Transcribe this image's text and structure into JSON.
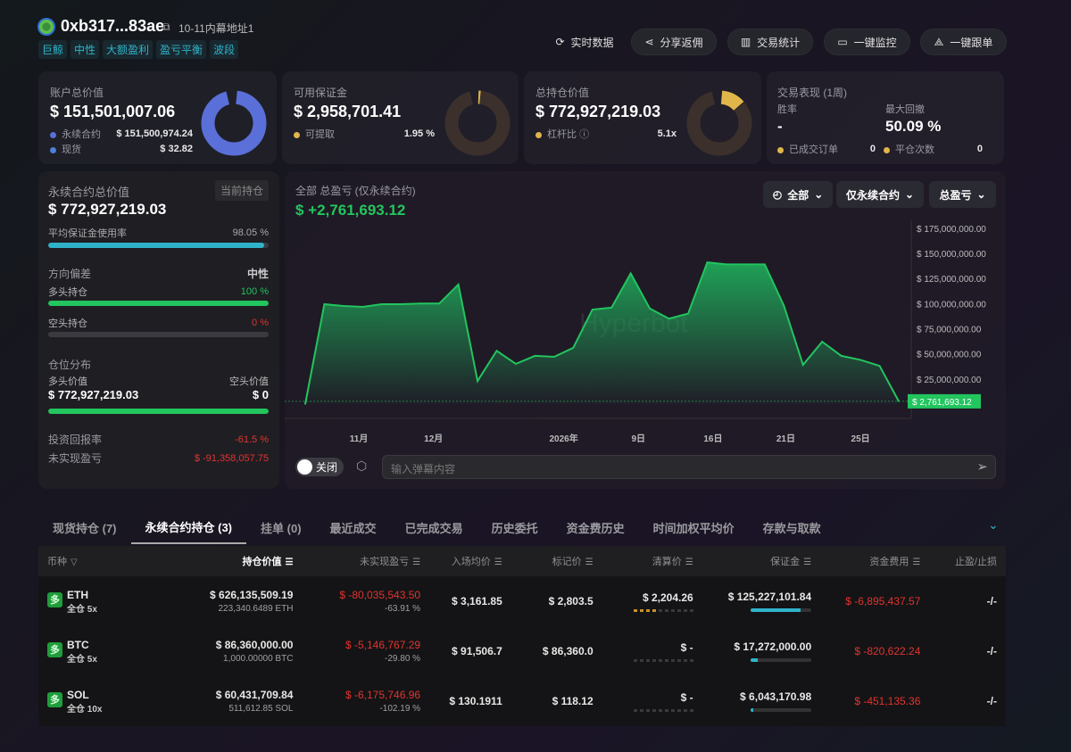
{
  "header": {
    "address": "0xb317...83ae",
    "alias": "10-11内幕地址1",
    "tags": [
      "巨鲸",
      "中性",
      "大额盈利",
      "盈亏平衡",
      "波段"
    ]
  },
  "toolbar": {
    "realtime": "实时数据",
    "share": "分享返佣",
    "stats": "交易统计",
    "monitor": "一键监控",
    "copy": "一键跟单"
  },
  "cards": {
    "account": {
      "title": "账户总价值",
      "value": "$ 151,501,007.06",
      "perp_label": "永续合约",
      "perp_value": "$ 151,500,974.24",
      "spot_label": "现货",
      "spot_value": "$ 32.82",
      "perp_color": "#5a6fd8",
      "spot_color": "#4f7fd8"
    },
    "margin": {
      "title": "可用保证金",
      "value": "$ 2,958,701.41",
      "withdraw_label": "可提取",
      "withdraw_pct": "1.95 %",
      "fraction": 0.0195
    },
    "position": {
      "title": "总持仓价值",
      "value": "$ 772,927,219.03",
      "leverage_label": "杠杆比",
      "leverage": "5.1x"
    },
    "performance": {
      "title": "交易表现 (1周)",
      "winrate_label": "胜率",
      "winrate": "-",
      "drawdown_label": "最大回撤",
      "drawdown": "50.09 %",
      "filled_label": "已成交订单",
      "filled": "0",
      "closed_label": "平仓次数",
      "closed": "0"
    }
  },
  "perp": {
    "title": "永续合约总价值",
    "badge": "当前持仓",
    "value": "$ 772,927,219.03",
    "margin_use_label": "平均保证金使用率",
    "margin_use": "98.05 %",
    "margin_use_frac": 0.9805,
    "bias_label": "方向偏差",
    "bias": "中性",
    "long_label": "多头持仓",
    "long_pct": "100 %",
    "long_frac": 1,
    "short_label": "空头持仓",
    "short_pct": "0 %",
    "short_frac": 0,
    "dist_label": "仓位分布",
    "long_value_label": "多头价值",
    "short_value_label": "空头价值",
    "long_value": "$ 772,927,219.03",
    "short_value": "$ 0",
    "roi_label": "投资回报率",
    "roi": "-61.5 %",
    "upnl_label": "未实现盈亏",
    "upnl": "$ -91,358,057.75"
  },
  "chart_panel": {
    "title": "全部 总盈亏 (仅永续合约)",
    "total": "$ +2,761,693.12",
    "dd_range": "全部",
    "dd_type": "仅永续合约",
    "dd_metric": "总盈亏",
    "watermark": "Hyperbot",
    "toggle": "关闭",
    "danmaku_placeholder": "输入弹幕内容"
  },
  "chart_data": {
    "type": "area",
    "title": "全部 总盈亏 (仅永续合约)",
    "ylim": [
      0,
      175000000
    ],
    "yticks": [
      {
        "v": 175000000,
        "label": "$ 175,000,000.00"
      },
      {
        "v": 150000000,
        "label": "$ 150,000,000.00"
      },
      {
        "v": 125000000,
        "label": "$ 125,000,000.00"
      },
      {
        "v": 100000000,
        "label": "$ 100,000,000.00"
      },
      {
        "v": 75000000,
        "label": "$ 75,000,000.00"
      },
      {
        "v": 50000000,
        "label": "$ 50,000,000.00"
      },
      {
        "v": 25000000,
        "label": "$ 25,000,000.00"
      }
    ],
    "xticks": [
      {
        "i": 2.8,
        "label": "11月"
      },
      {
        "i": 6.7,
        "label": "12月"
      },
      {
        "i": 13.5,
        "label": "2026年"
      },
      {
        "i": 17.4,
        "label": "9日"
      },
      {
        "i": 21.3,
        "label": "16日"
      },
      {
        "i": 25.1,
        "label": "21日"
      },
      {
        "i": 29,
        "label": "25日"
      }
    ],
    "values": [
      0,
      99400000,
      97600000,
      96700000,
      99400000,
      99400000,
      100000000,
      100000000,
      119000000,
      23000000,
      53000000,
      40000000,
      48000000,
      47000000,
      56000000,
      94000000,
      96000000,
      130000000,
      95000000,
      85000000,
      90000000,
      141000000,
      139000000,
      139000000,
      139000000,
      98000000,
      39000000,
      62000000,
      48000000,
      44000000,
      38000000,
      2761693.12
    ],
    "last_label": "$ 2,761,693.12",
    "color": "#22c55e"
  },
  "tabs": [
    "现货持仓 (7)",
    "永续合约持仓 (3)",
    "挂单 (0)",
    "最近成交",
    "已完成交易",
    "历史委托",
    "资金费历史",
    "时间加权平均价",
    "存款与取款"
  ],
  "table": {
    "headers": [
      "币种",
      "持仓价值",
      "未实现盈亏",
      "入场均价",
      "标记价",
      "清算价",
      "保证金",
      "资金费用",
      "止盈/止损"
    ],
    "rows": [
      {
        "side": "多",
        "coin": "ETH",
        "mode": "全仓 5x",
        "value": "$ 626,135,509.19",
        "size": "223,340.6489 ETH",
        "upnl": "$ -80,035,543.50",
        "upnl_pct": "-63.91 %",
        "entry": "$ 3,161.85",
        "mark": "$ 2,803.5",
        "liq": "$ 2,204.26",
        "liq_level": 4,
        "margin": "$ 125,227,101.84",
        "margin_frac": 0.82,
        "funding": "$ -6,895,437.57",
        "tpsl": "-/-"
      },
      {
        "side": "多",
        "coin": "BTC",
        "mode": "全仓 5x",
        "value": "$ 86,360,000.00",
        "size": "1,000.00000 BTC",
        "upnl": "$ -5,146,767.29",
        "upnl_pct": "-29.80 %",
        "entry": "$ 91,506.7",
        "mark": "$ 86,360.0",
        "liq": "$ -",
        "liq_level": 0,
        "margin": "$ 17,272,000.00",
        "margin_frac": 0.11,
        "funding": "$ -820,622.24",
        "tpsl": "-/-"
      },
      {
        "side": "多",
        "coin": "SOL",
        "mode": "全仓 10x",
        "value": "$ 60,431,709.84",
        "size": "511,612.85 SOL",
        "upnl": "$ -6,175,746.96",
        "upnl_pct": "-102.19 %",
        "entry": "$ 130.1911",
        "mark": "$ 118.12",
        "liq": "$ -",
        "liq_level": 0,
        "margin": "$ 6,043,170.98",
        "margin_frac": 0.04,
        "funding": "$ -451,135.36",
        "tpsl": "-/-"
      }
    ]
  }
}
